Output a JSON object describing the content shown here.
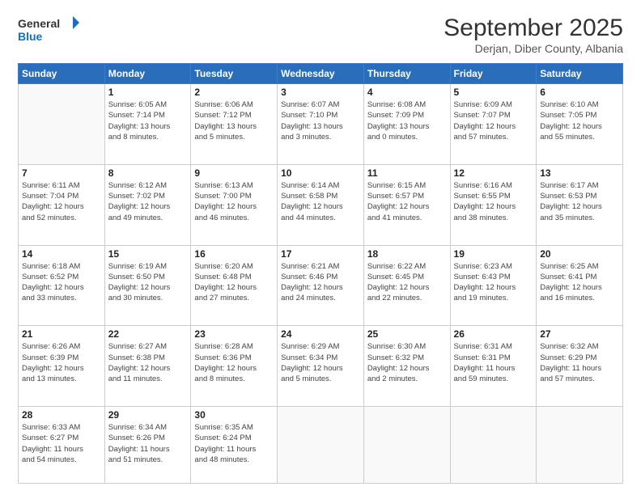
{
  "logo": {
    "line1": "General",
    "line2": "Blue"
  },
  "title": "September 2025",
  "location": "Derjan, Diber County, Albania",
  "days_header": [
    "Sunday",
    "Monday",
    "Tuesday",
    "Wednesday",
    "Thursday",
    "Friday",
    "Saturday"
  ],
  "weeks": [
    [
      {
        "day": "",
        "info": ""
      },
      {
        "day": "1",
        "info": "Sunrise: 6:05 AM\nSunset: 7:14 PM\nDaylight: 13 hours\nand 8 minutes."
      },
      {
        "day": "2",
        "info": "Sunrise: 6:06 AM\nSunset: 7:12 PM\nDaylight: 13 hours\nand 5 minutes."
      },
      {
        "day": "3",
        "info": "Sunrise: 6:07 AM\nSunset: 7:10 PM\nDaylight: 13 hours\nand 3 minutes."
      },
      {
        "day": "4",
        "info": "Sunrise: 6:08 AM\nSunset: 7:09 PM\nDaylight: 13 hours\nand 0 minutes."
      },
      {
        "day": "5",
        "info": "Sunrise: 6:09 AM\nSunset: 7:07 PM\nDaylight: 12 hours\nand 57 minutes."
      },
      {
        "day": "6",
        "info": "Sunrise: 6:10 AM\nSunset: 7:05 PM\nDaylight: 12 hours\nand 55 minutes."
      }
    ],
    [
      {
        "day": "7",
        "info": "Sunrise: 6:11 AM\nSunset: 7:04 PM\nDaylight: 12 hours\nand 52 minutes."
      },
      {
        "day": "8",
        "info": "Sunrise: 6:12 AM\nSunset: 7:02 PM\nDaylight: 12 hours\nand 49 minutes."
      },
      {
        "day": "9",
        "info": "Sunrise: 6:13 AM\nSunset: 7:00 PM\nDaylight: 12 hours\nand 46 minutes."
      },
      {
        "day": "10",
        "info": "Sunrise: 6:14 AM\nSunset: 6:58 PM\nDaylight: 12 hours\nand 44 minutes."
      },
      {
        "day": "11",
        "info": "Sunrise: 6:15 AM\nSunset: 6:57 PM\nDaylight: 12 hours\nand 41 minutes."
      },
      {
        "day": "12",
        "info": "Sunrise: 6:16 AM\nSunset: 6:55 PM\nDaylight: 12 hours\nand 38 minutes."
      },
      {
        "day": "13",
        "info": "Sunrise: 6:17 AM\nSunset: 6:53 PM\nDaylight: 12 hours\nand 35 minutes."
      }
    ],
    [
      {
        "day": "14",
        "info": "Sunrise: 6:18 AM\nSunset: 6:52 PM\nDaylight: 12 hours\nand 33 minutes."
      },
      {
        "day": "15",
        "info": "Sunrise: 6:19 AM\nSunset: 6:50 PM\nDaylight: 12 hours\nand 30 minutes."
      },
      {
        "day": "16",
        "info": "Sunrise: 6:20 AM\nSunset: 6:48 PM\nDaylight: 12 hours\nand 27 minutes."
      },
      {
        "day": "17",
        "info": "Sunrise: 6:21 AM\nSunset: 6:46 PM\nDaylight: 12 hours\nand 24 minutes."
      },
      {
        "day": "18",
        "info": "Sunrise: 6:22 AM\nSunset: 6:45 PM\nDaylight: 12 hours\nand 22 minutes."
      },
      {
        "day": "19",
        "info": "Sunrise: 6:23 AM\nSunset: 6:43 PM\nDaylight: 12 hours\nand 19 minutes."
      },
      {
        "day": "20",
        "info": "Sunrise: 6:25 AM\nSunset: 6:41 PM\nDaylight: 12 hours\nand 16 minutes."
      }
    ],
    [
      {
        "day": "21",
        "info": "Sunrise: 6:26 AM\nSunset: 6:39 PM\nDaylight: 12 hours\nand 13 minutes."
      },
      {
        "day": "22",
        "info": "Sunrise: 6:27 AM\nSunset: 6:38 PM\nDaylight: 12 hours\nand 11 minutes."
      },
      {
        "day": "23",
        "info": "Sunrise: 6:28 AM\nSunset: 6:36 PM\nDaylight: 12 hours\nand 8 minutes."
      },
      {
        "day": "24",
        "info": "Sunrise: 6:29 AM\nSunset: 6:34 PM\nDaylight: 12 hours\nand 5 minutes."
      },
      {
        "day": "25",
        "info": "Sunrise: 6:30 AM\nSunset: 6:32 PM\nDaylight: 12 hours\nand 2 minutes."
      },
      {
        "day": "26",
        "info": "Sunrise: 6:31 AM\nSunset: 6:31 PM\nDaylight: 11 hours\nand 59 minutes."
      },
      {
        "day": "27",
        "info": "Sunrise: 6:32 AM\nSunset: 6:29 PM\nDaylight: 11 hours\nand 57 minutes."
      }
    ],
    [
      {
        "day": "28",
        "info": "Sunrise: 6:33 AM\nSunset: 6:27 PM\nDaylight: 11 hours\nand 54 minutes."
      },
      {
        "day": "29",
        "info": "Sunrise: 6:34 AM\nSunset: 6:26 PM\nDaylight: 11 hours\nand 51 minutes."
      },
      {
        "day": "30",
        "info": "Sunrise: 6:35 AM\nSunset: 6:24 PM\nDaylight: 11 hours\nand 48 minutes."
      },
      {
        "day": "",
        "info": ""
      },
      {
        "day": "",
        "info": ""
      },
      {
        "day": "",
        "info": ""
      },
      {
        "day": "",
        "info": ""
      }
    ]
  ]
}
